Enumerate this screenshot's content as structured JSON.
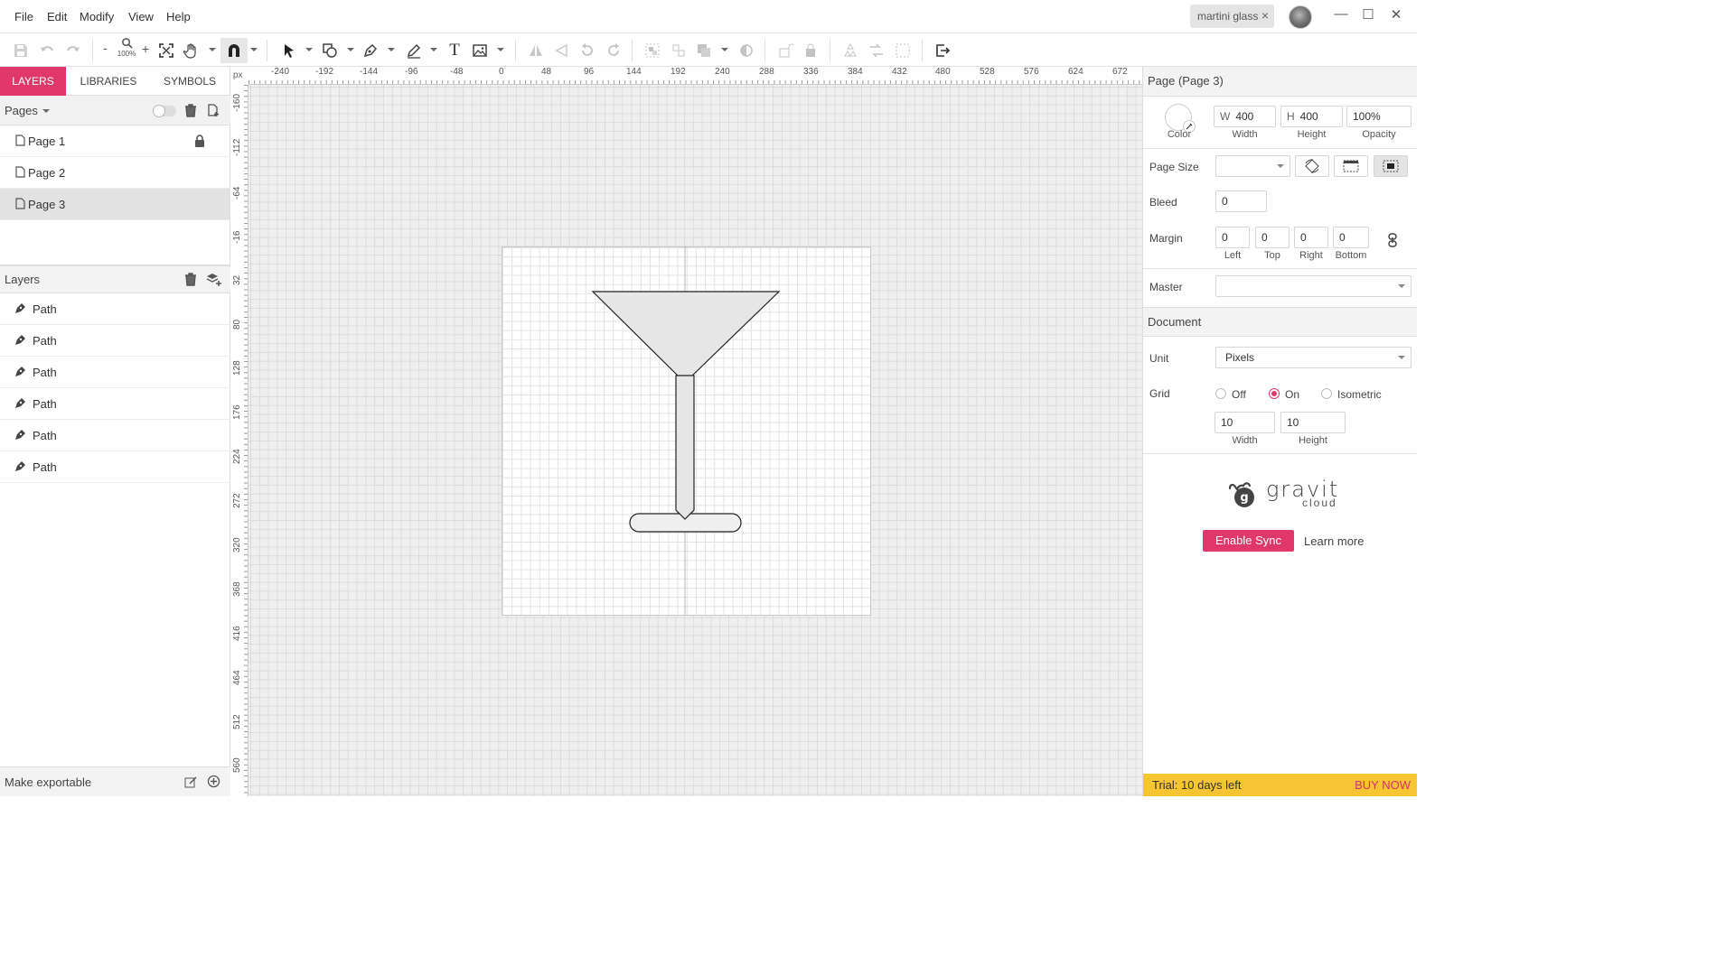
{
  "menubar": {
    "items": [
      "File",
      "Edit",
      "Modify",
      "View",
      "Help"
    ],
    "document_tab": "martini glass",
    "window_controls": [
      "minimize-icon",
      "maximize-icon",
      "close-icon"
    ]
  },
  "toolbar": {
    "zoom_minus": "-",
    "zoom_level": "100%",
    "zoom_plus": "+",
    "text_tool": "T"
  },
  "left_panel": {
    "tabs": [
      "LAYERS",
      "LIBRARIES",
      "SYMBOLS"
    ],
    "active_tab": "LAYERS",
    "pages_title": "Pages",
    "pages": [
      "Page 1",
      "Page 2",
      "Page 3"
    ],
    "selected_page": "Page 3",
    "layers_title": "Layers",
    "layers": [
      "Path",
      "Path",
      "Path",
      "Path",
      "Path",
      "Path"
    ],
    "footer": "Make exportable"
  },
  "rulers": {
    "unit": "px",
    "top": [
      "-240",
      "-192",
      "-144",
      "-96",
      "-48",
      "0",
      "48",
      "96",
      "144",
      "192",
      "240",
      "288",
      "336",
      "384",
      "432",
      "480",
      "528",
      "576",
      "624",
      "672"
    ],
    "left": [
      "-160",
      "-112",
      "-64",
      "-16",
      "32",
      "80",
      "128",
      "176",
      "224",
      "272",
      "320",
      "368",
      "416",
      "464",
      "512",
      "560"
    ]
  },
  "right_panel": {
    "title": "Page (Page 3)",
    "color_label": "Color",
    "width": {
      "prefix": "W",
      "value": "400",
      "label": "Width"
    },
    "height": {
      "prefix": "H",
      "value": "400",
      "label": "Height"
    },
    "opacity": {
      "value": "100%",
      "label": "Opacity"
    },
    "page_size_label": "Page Size",
    "bleed_label": "Bleed",
    "bleed_value": "0",
    "margin_label": "Margin",
    "margins": [
      {
        "value": "0",
        "label": "Left"
      },
      {
        "value": "0",
        "label": "Top"
      },
      {
        "value": "0",
        "label": "Right"
      },
      {
        "value": "0",
        "label": "Bottom"
      }
    ],
    "master_label": "Master",
    "document_title": "Document",
    "unit_label": "Unit",
    "unit_value": "Pixels",
    "grid_label": "Grid",
    "grid_options": [
      "Off",
      "On",
      "Isometric"
    ],
    "grid_selected": "On",
    "grid_width": {
      "value": "10",
      "label": "Width"
    },
    "grid_height": {
      "value": "10",
      "label": "Height"
    },
    "brand": {
      "name": "gravit",
      "sub": "cloud"
    },
    "enable_sync": "Enable Sync",
    "learn_more": "Learn more",
    "trial_text": "Trial: 10 days left",
    "buy_now": "BUY NOW"
  },
  "colors": {
    "accent": "#e0386a",
    "trial_bar": "#f7c531",
    "glass_fill": "#e6e6e6",
    "glass_stroke": "#222222"
  }
}
